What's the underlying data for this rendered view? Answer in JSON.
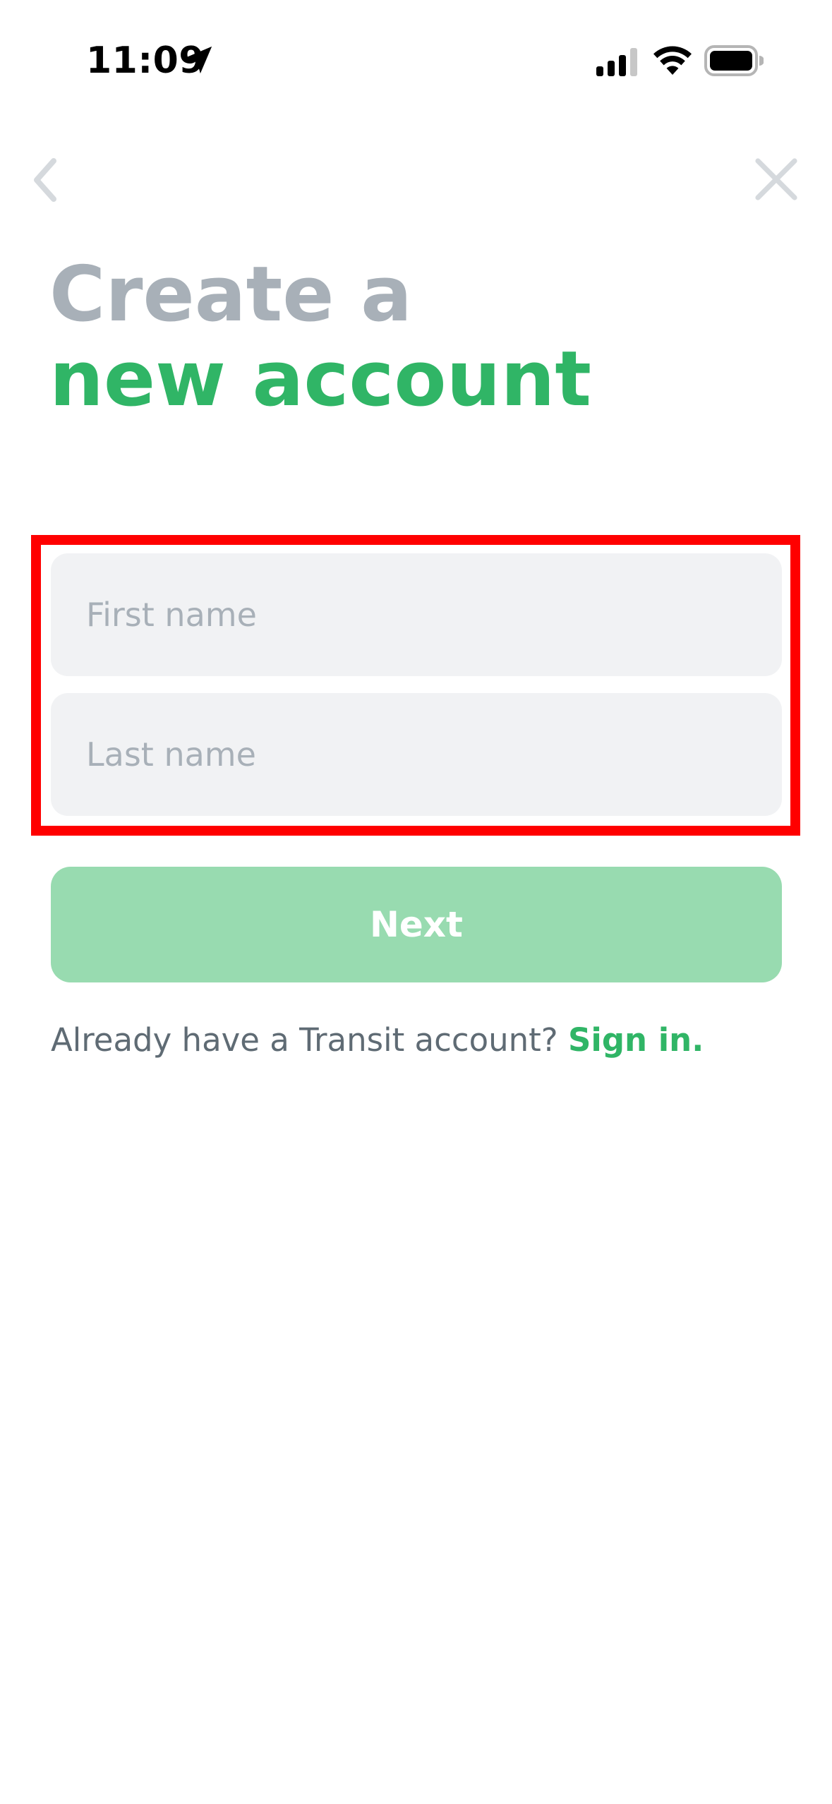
{
  "status_bar": {
    "time": "11:09"
  },
  "header": {
    "title_line1": "Create a",
    "title_line2": "new account"
  },
  "form": {
    "first_name_placeholder": "First name",
    "first_name_value": "",
    "last_name_placeholder": "Last name",
    "last_name_value": "",
    "next_label": "Next"
  },
  "footer": {
    "prompt": "Already have a Transit account?",
    "signin_label": "Sign in."
  },
  "colors": {
    "accent": "#30b566",
    "accent_disabled": "#98dbb0",
    "muted_title": "#a8b0b8",
    "field_bg": "#f1f2f4",
    "highlight": "#ff0000"
  },
  "icons": {
    "location": "location-arrow-icon",
    "signal": "cellular-signal-icon",
    "wifi": "wifi-icon",
    "battery": "battery-icon",
    "back": "chevron-left-icon",
    "close": "close-icon"
  }
}
